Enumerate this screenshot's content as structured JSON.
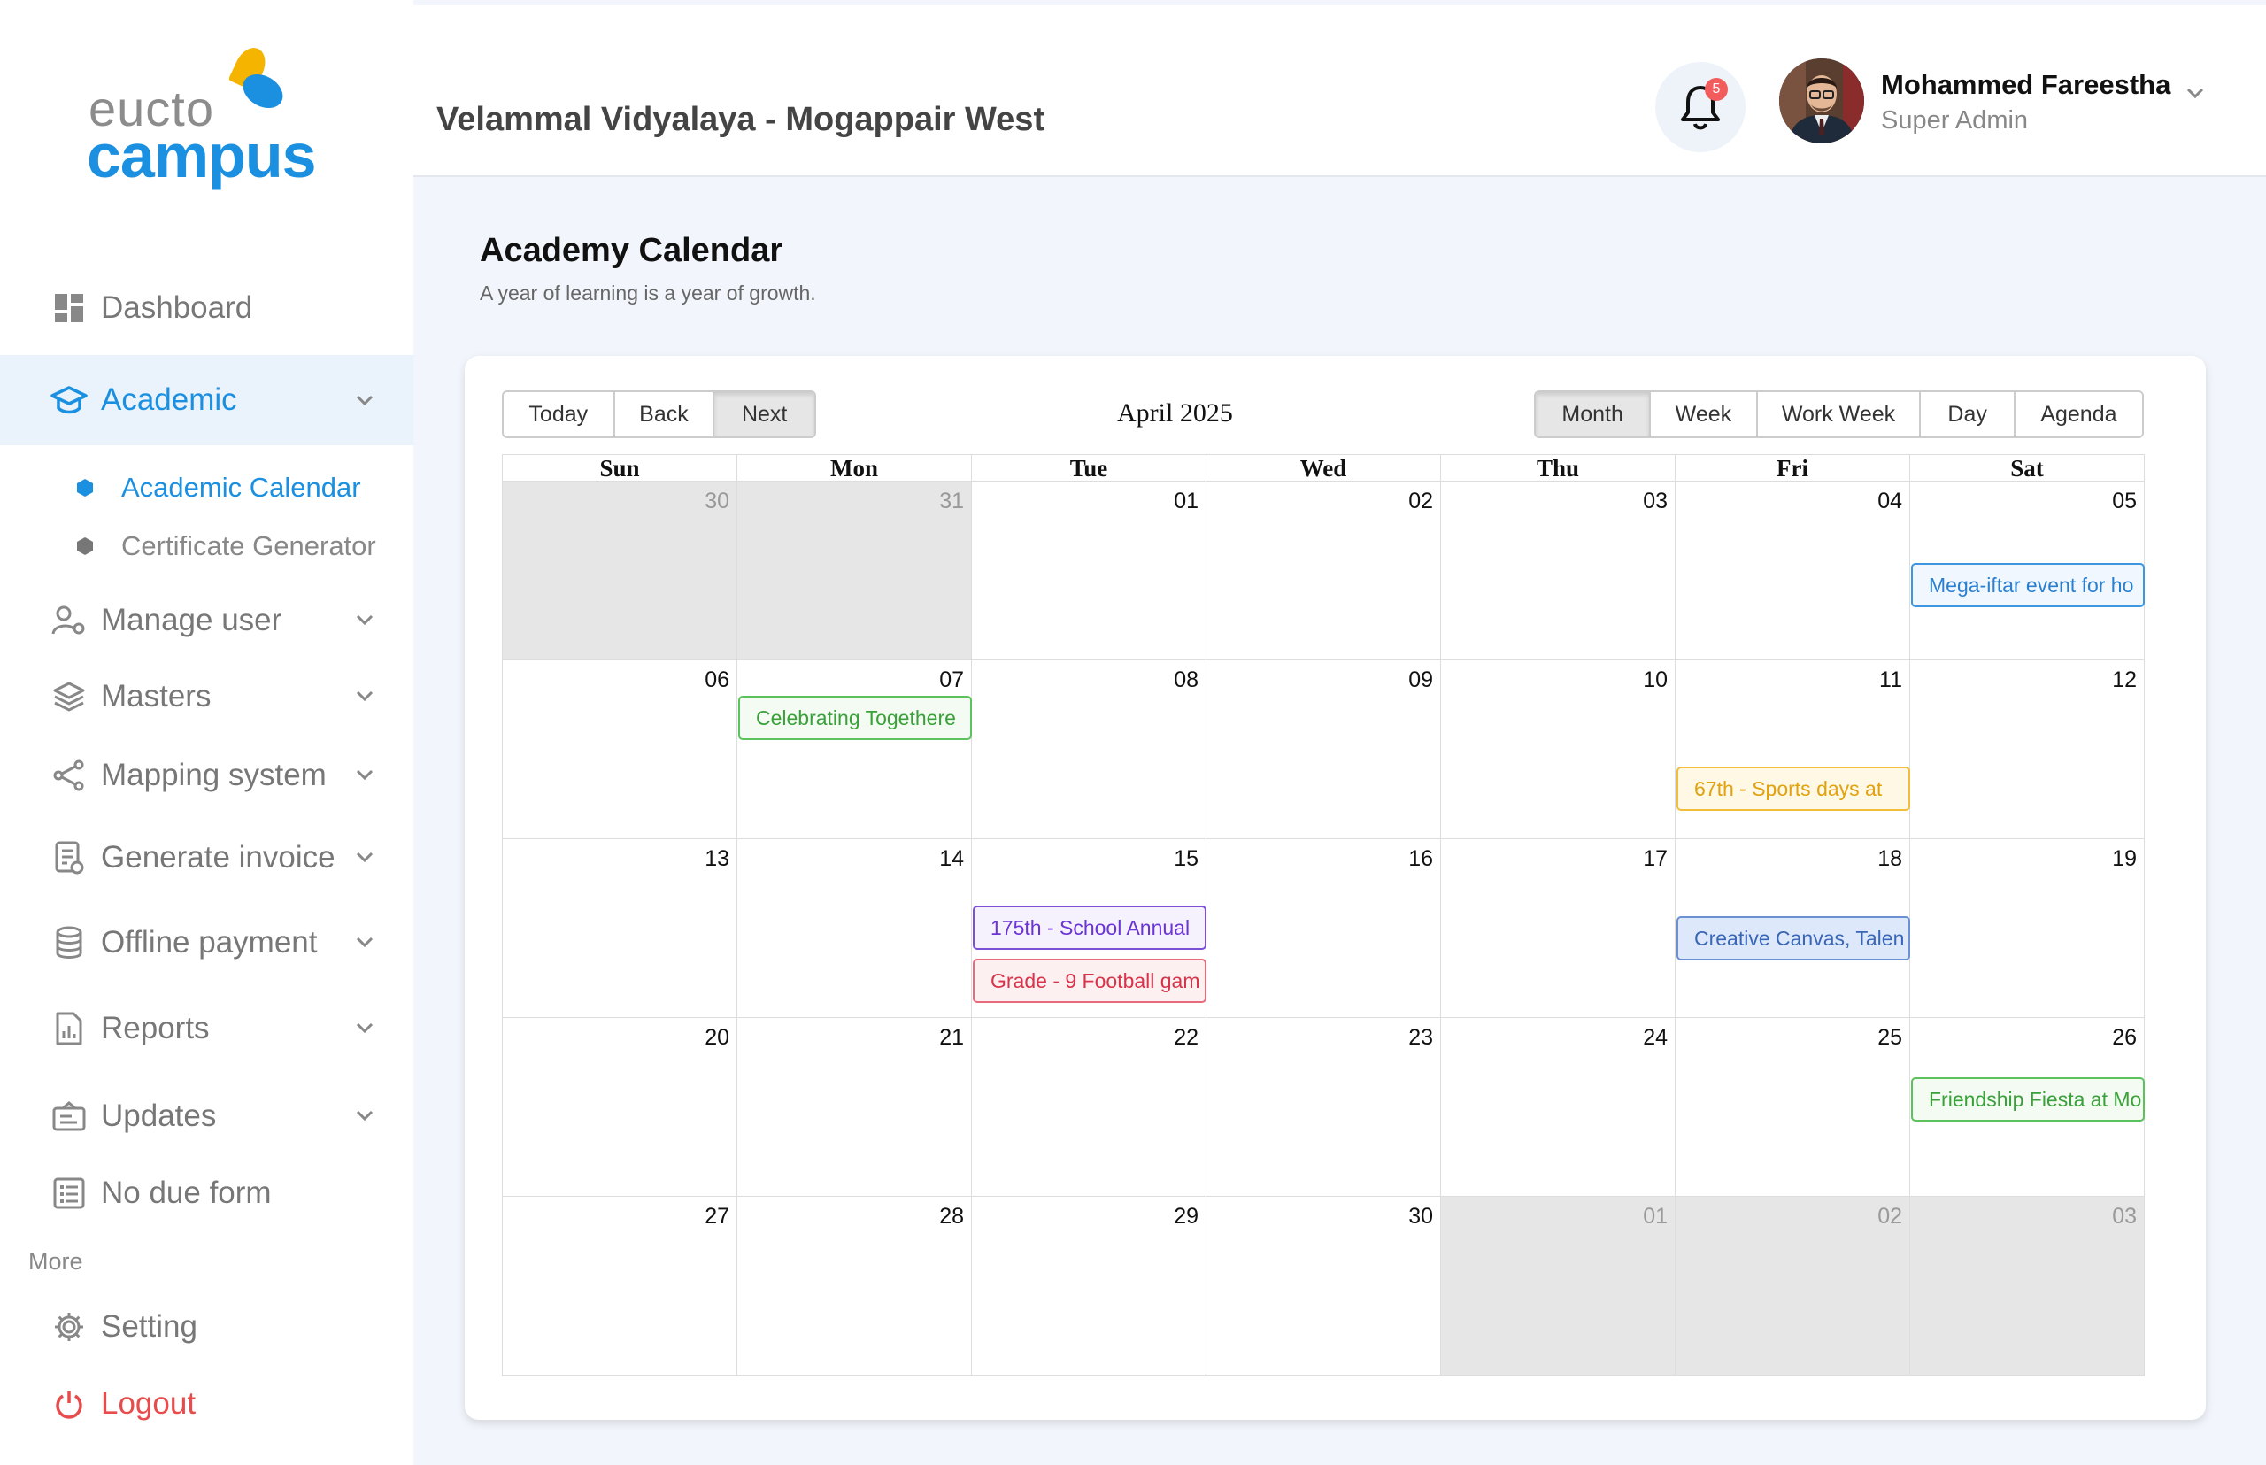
{
  "brand": {
    "logo_top": "eucto",
    "logo_bottom": "campus"
  },
  "sidebar": {
    "items": [
      {
        "label": "Dashboard"
      },
      {
        "label": "Academic"
      },
      {
        "label": "Manage user"
      },
      {
        "label": "Masters"
      },
      {
        "label": "Mapping system"
      },
      {
        "label": "Generate invoice"
      },
      {
        "label": "Offline payment"
      },
      {
        "label": "Reports"
      },
      {
        "label": "Updates"
      },
      {
        "label": "No due form"
      }
    ],
    "sub_items": [
      {
        "label": "Academic Calendar"
      },
      {
        "label": "Certificate Generator"
      }
    ],
    "more_label": "More",
    "setting_label": "Setting",
    "logout_label": "Logout"
  },
  "header": {
    "school": "Velammal Vidyalaya - Mogappair West",
    "notification_count": "5",
    "user_name": "Mohammed Fareestha",
    "user_role": "Super Admin"
  },
  "page": {
    "title": "Academy Calendar",
    "subtitle": "A year of learning is a year of growth."
  },
  "calendar": {
    "nav_buttons": [
      "Today",
      "Back",
      "Next"
    ],
    "month_label": "April 2025",
    "view_buttons": [
      "Month",
      "Week",
      "Work Week",
      "Day",
      "Agenda"
    ],
    "active_view": "Month",
    "weekdays": [
      "Sun",
      "Mon",
      "Tue",
      "Wed",
      "Thu",
      "Fri",
      "Sat"
    ],
    "weeks": [
      [
        "30",
        "31",
        "01",
        "02",
        "03",
        "04",
        "05"
      ],
      [
        "06",
        "07",
        "08",
        "09",
        "10",
        "11",
        "12"
      ],
      [
        "13",
        "14",
        "15",
        "16",
        "17",
        "18",
        "19"
      ],
      [
        "20",
        "21",
        "22",
        "23",
        "24",
        "25",
        "26"
      ],
      [
        "27",
        "28",
        "29",
        "30",
        "01",
        "02",
        "03"
      ]
    ],
    "events": [
      {
        "label": "Mega-iftar event for ho",
        "color": "#3d96e0"
      },
      {
        "label": "Celebrating Togethere",
        "color": "#5cc25c"
      },
      {
        "label": "67th - Sports days at",
        "color": "#f1bd3a"
      },
      {
        "label": "175th - School Annual",
        "color": "#7b4fd6"
      },
      {
        "label": "Grade - 9 Football gam",
        "color": "#e96a7a"
      },
      {
        "label": "Creative Canvas, Talen",
        "color": "#6a8fd3"
      },
      {
        "label": "Friendship Fiesta at Mo",
        "color": "#5cc25c"
      }
    ]
  }
}
